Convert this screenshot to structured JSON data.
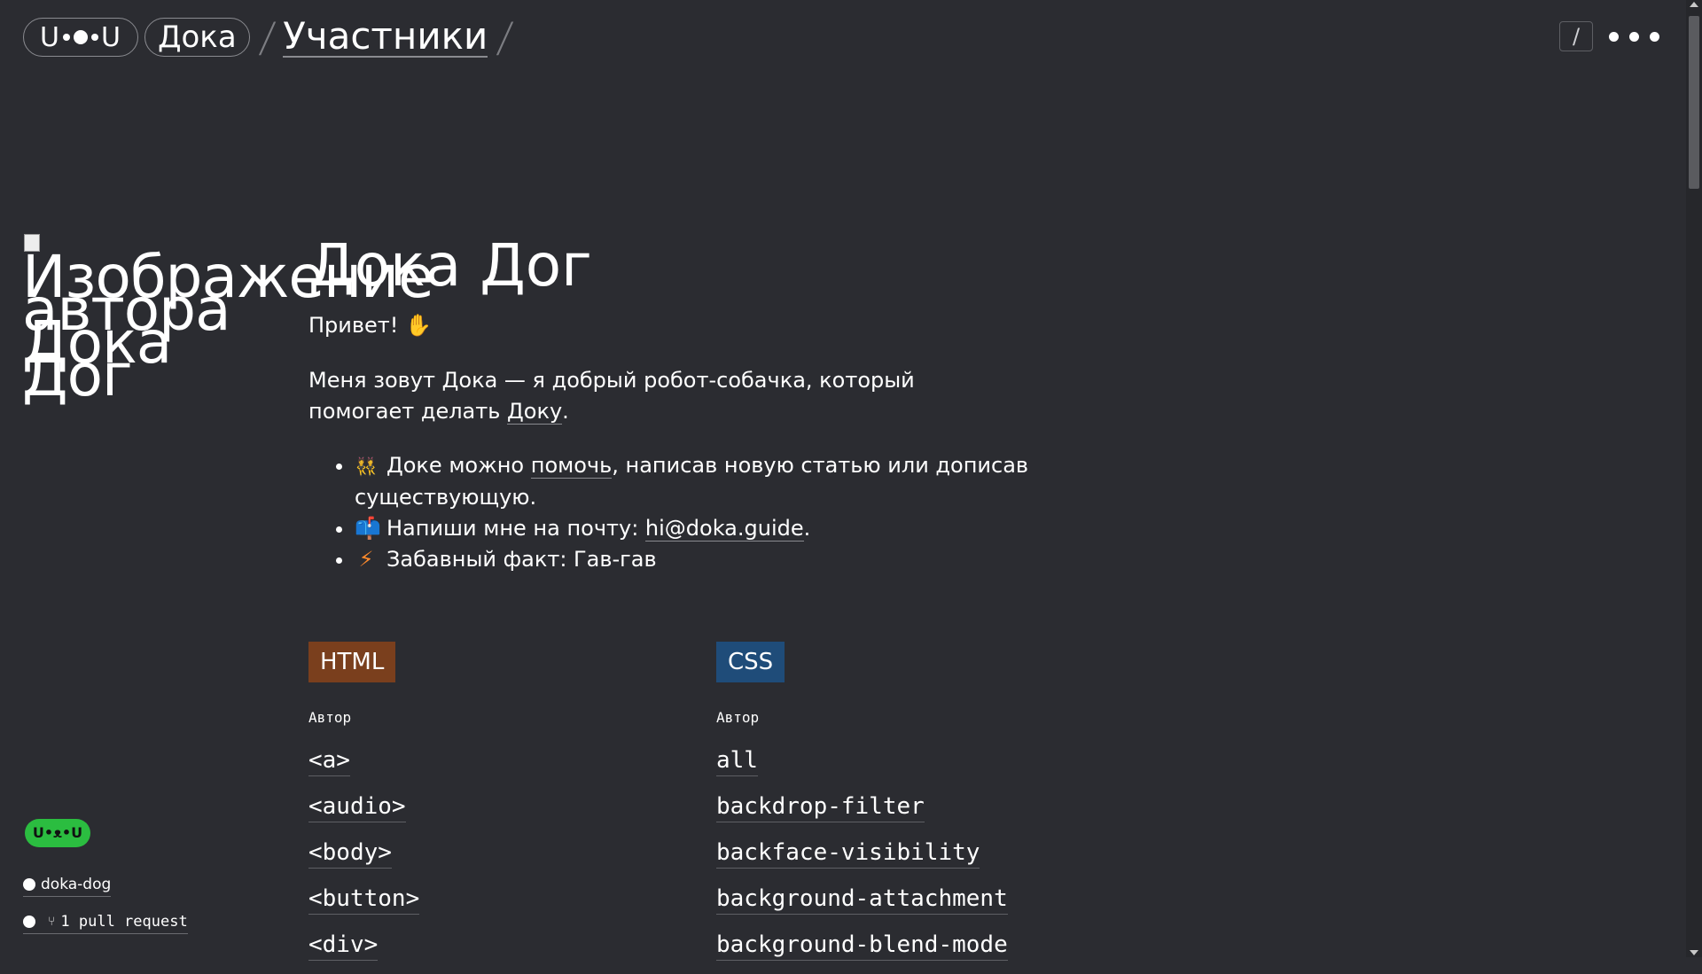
{
  "header": {
    "logo_text": "U•ᴥ•U",
    "logo_left": "U",
    "logo_right": "U",
    "section": "Дока",
    "separator": "/",
    "current": "Участники",
    "search_icon": "/"
  },
  "sidebar": {
    "avatar_alt": "Изображение автора Дока Дог",
    "badge": "U•ᴥ•U",
    "github_user": "doka-dog",
    "pull_requests": "1 pull request"
  },
  "profile": {
    "name": "Дока Дог",
    "greeting": "Привет!",
    "greeting_emoji": "✋",
    "intro_before": "Меня зовут Дока — я добрый робот-собачка, который помогает делать ",
    "intro_link": "Доку",
    "intro_after": ".",
    "bullets": [
      {
        "emoji": "👯",
        "before": "Доке можно ",
        "link": "помочь",
        "after": ", написав новую статью или дописав существующую."
      },
      {
        "emoji": "📫",
        "before": "Напиши мне на почту: ",
        "link": "hi@doka.guide",
        "after": "."
      },
      {
        "emoji": "⚡",
        "before": "Забавный факт: Гав-гав",
        "link": "",
        "after": ""
      }
    ]
  },
  "columns": [
    {
      "tag": "HTML",
      "role": "Автор",
      "items": [
        "<a>",
        "<audio>",
        "<body>",
        "<button>",
        "<div>"
      ]
    },
    {
      "tag": "CSS",
      "role": "Автор",
      "items": [
        "all",
        "backdrop-filter",
        "backface-visibility",
        "background-attachment",
        "background-blend-mode"
      ]
    }
  ],
  "colors": {
    "background": "#2b2c31",
    "html_tag": "#7a3f1d",
    "css_tag": "#1f4c79",
    "badge": "#2bbd40"
  }
}
